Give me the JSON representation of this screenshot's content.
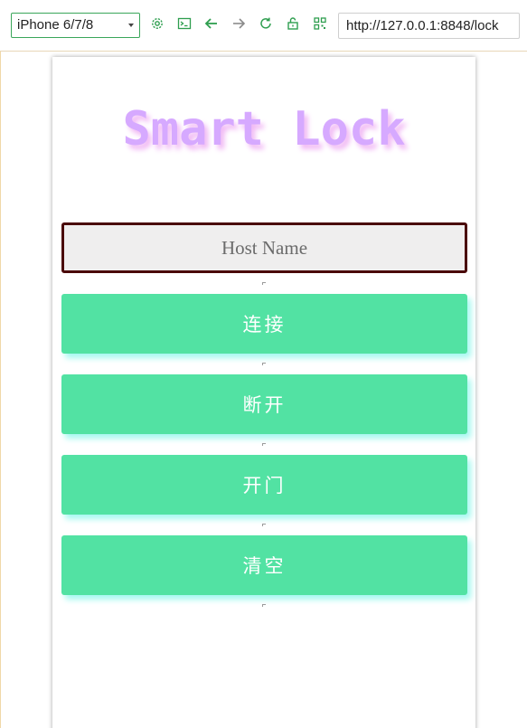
{
  "toolbar": {
    "device": "iPhone 6/7/8",
    "url": "http://127.0.0.1:8848/lock",
    "icons": [
      "settings-icon",
      "console-icon",
      "back-arrow-icon",
      "forward-arrow-icon",
      "reload-icon",
      "unlock-icon",
      "qr-code-icon"
    ],
    "accent_color": "#2e9e4f"
  },
  "app": {
    "title": "Smart Lock",
    "title_color": "#d6a9ff",
    "host_input": {
      "placeholder": "Host Name",
      "value": ""
    },
    "buttons": [
      {
        "label": "连接"
      },
      {
        "label": "断开"
      },
      {
        "label": "开门"
      },
      {
        "label": "清空"
      }
    ],
    "button_color": "#52e2a3"
  }
}
